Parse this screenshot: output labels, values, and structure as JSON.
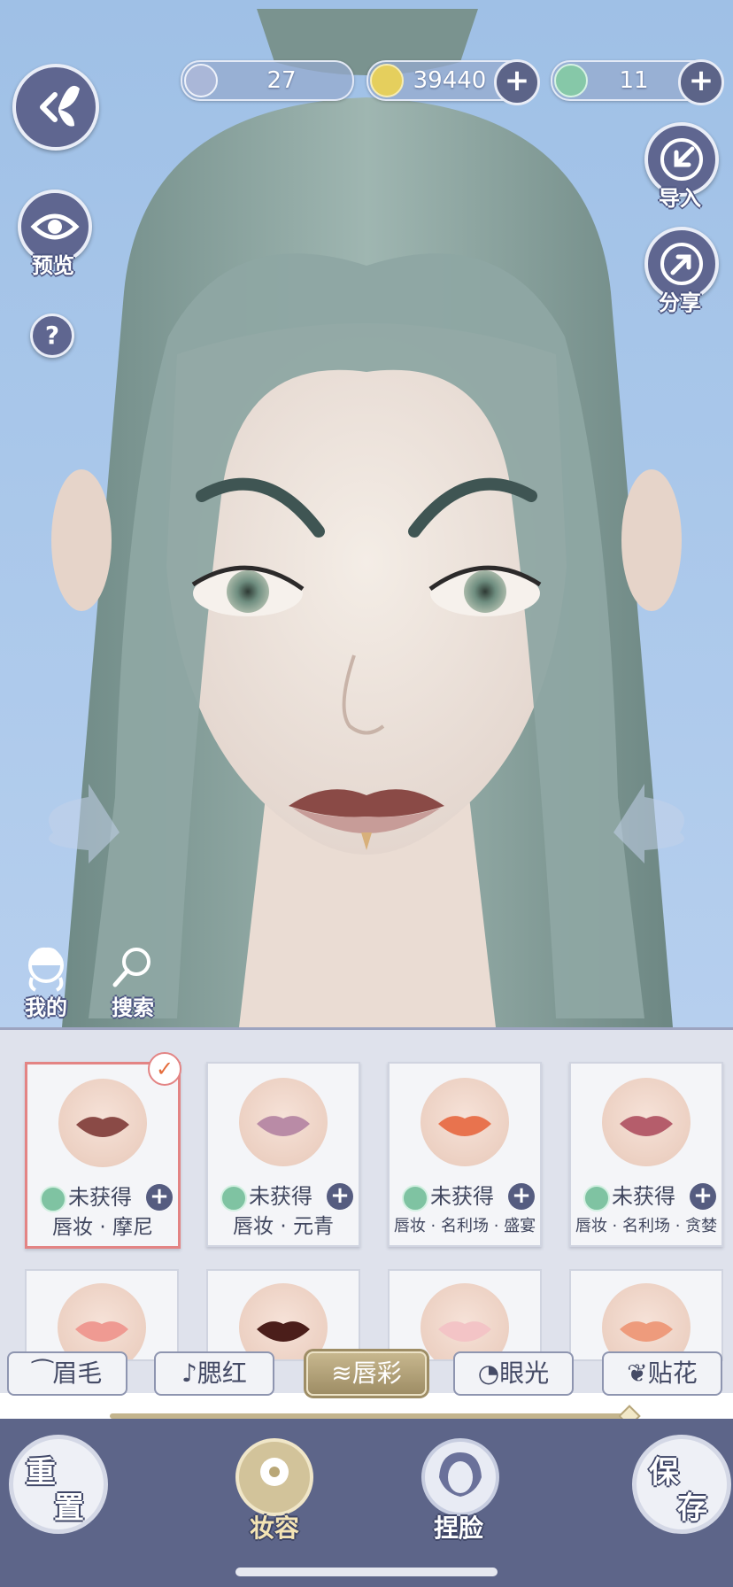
{
  "currency": {
    "feather": "27",
    "coins": "39440",
    "jade": "11"
  },
  "left_buttons": {
    "preview_label": "预览",
    "help_label": "?",
    "mine_label": "我的",
    "search_label": "搜索"
  },
  "right_buttons": {
    "import_label": "导入",
    "share_label": "分享"
  },
  "items": [
    {
      "status": "未获得",
      "name": "唇妆 · 摩尼",
      "selected": true
    },
    {
      "status": "未获得",
      "name": "唇妆 · 元青",
      "selected": false
    },
    {
      "status": "未获得",
      "name": "唇妆 · 名利场 · 盛宴",
      "selected": false
    },
    {
      "status": "未获得",
      "name": "唇妆 · 名利场 · 贪婪",
      "selected": false
    }
  ],
  "tabs": [
    {
      "label": "眉毛"
    },
    {
      "label": "腮红"
    },
    {
      "label": "唇彩"
    },
    {
      "label": "眼光"
    },
    {
      "label": "贴花"
    }
  ],
  "active_tab": "唇彩",
  "bottom": {
    "reset_label_1": "重",
    "reset_label_2": "置",
    "makeup_label": "妆容",
    "face_label": "捏脸",
    "save_label_1": "保",
    "save_label_2": "存"
  },
  "colors": {
    "accent": "#5d6589",
    "selected_border": "#e38484",
    "active_tab": "#b3a37a"
  }
}
